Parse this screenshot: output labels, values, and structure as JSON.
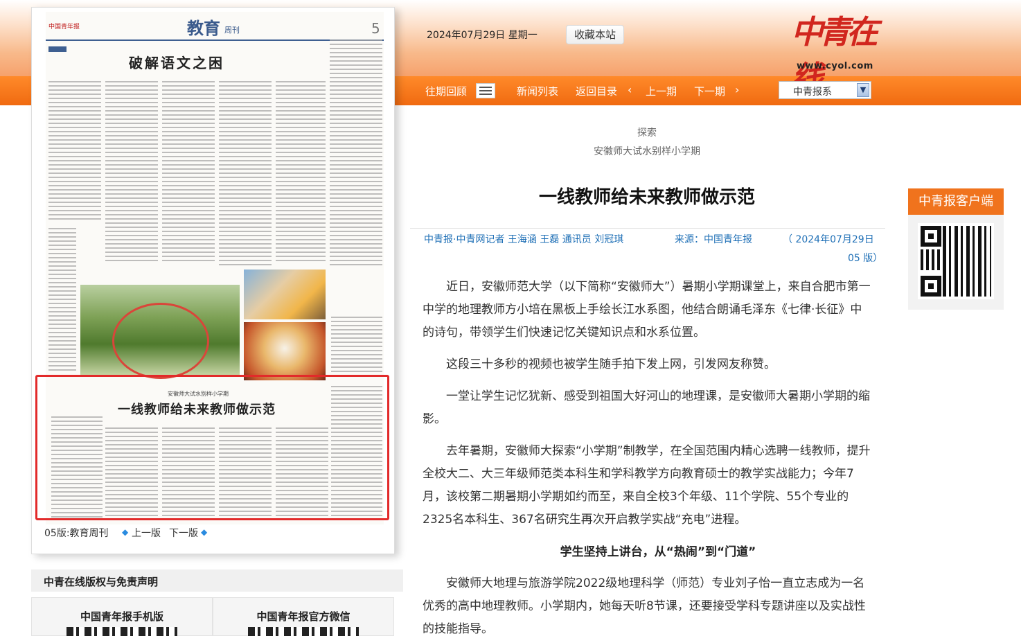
{
  "header": {
    "date": "2024年07月29日  星期一",
    "favorite_label": "收藏本站",
    "logo_text": "中青在线",
    "logo_url": "www.cyol.com"
  },
  "nav": {
    "past_issues": "往期回顾",
    "news_list": "新闻列表",
    "back_to_index": "返回目录",
    "prev_issue": "上一期",
    "next_issue": "下一期",
    "paper_select": "中青报系",
    "dropdown_glyph": "▼"
  },
  "newspaper": {
    "masthead": "中国青年报",
    "section": "教育",
    "weekly": "周刊",
    "page_no": "5",
    "top_headline": "破解语文之困",
    "highlight_subtitle": "安徽师大试水别样小学期",
    "highlight_headline": "一线教师给未来教师做示范",
    "footer_page": "05版:教育周刊",
    "footer_prev": "上一版",
    "footer_next": "下一版",
    "arrow_left_glyph": "◆",
    "arrow_right_glyph": "◆"
  },
  "sidebar_bottom": {
    "copyright_title": "中青在线版权与免责声明",
    "mobile_title": "中国青年报手机版",
    "wechat_title": "中国青年报官方微信"
  },
  "article": {
    "kicker": "探索",
    "subhead": "安徽师大试水别样小学期",
    "title": "一线教师给未来教师做示范",
    "byline_authors": "中青报·中青网记者  王海涵  王磊  通讯员  刘冠琪",
    "byline_source": "来源：中国青年报",
    "byline_date": "（  2024年07月29日",
    "byline_page": "05  版）",
    "paragraphs": [
      "近日，安徽师范大学（以下简称“安徽师大”）暑期小学期课堂上，来自合肥市第一中学的地理教师方小培在黑板上手绘长江水系图，他结合朗诵毛泽东《七律·长征》中的诗句，带领学生们快速记忆关键知识点和水系位置。",
      "这段三十多秒的视频也被学生随手拍下发上网，引发网友称赞。",
      "一堂让学生记忆犹新、感受到祖国大好河山的地理课，是安徽师大暑期小学期的缩影。",
      "去年暑期，安徽师大探索“小学期”制教学，在全国范围内精心选聘一线教师，提升全校大二、大三年级师范类本科生和学科教学方向教育硕士的教学实战能力；今年7月，该校第二期暑期小学期如约而至，来自全校3个年级、11个学院、55个专业的2325名本科生、367名研究生再次开启教学实战“充电”进程。",
      "安徽师大地理与旅游学院2022级地理科学（师范）专业刘子怡一直立志成为一名优秀的高中地理教师。小学期内，她每天听8节课，还要接受学科专题讲座以及实战性的技能指导。"
    ],
    "section_heading": "学生坚持上讲台，从“热闹”到“门道”"
  },
  "client_box": {
    "title": "中青报客户端"
  },
  "colors": {
    "accent_orange": "#f06a10",
    "highlight_red": "#e22a2a",
    "link_blue": "#1e6fb6"
  }
}
